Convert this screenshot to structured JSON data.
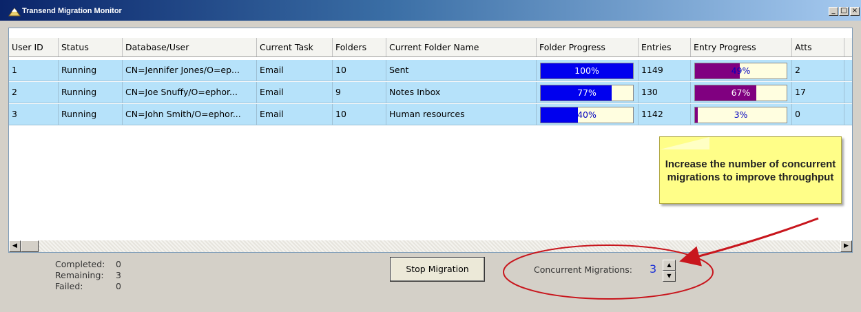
{
  "window": {
    "title": "Transend Migration Monitor"
  },
  "columns": [
    "User ID",
    "Status",
    "Database/User",
    "Current Task",
    "Folders",
    "Current Folder Name",
    "Folder Progress",
    "Entries",
    "Entry Progress",
    "Atts"
  ],
  "rows": [
    {
      "user_id": "1",
      "status": "Running",
      "database_user": "CN=Jennifer Jones/O=ep...",
      "current_task": "Email",
      "folders": "10",
      "current_folder_name": "Sent",
      "folder_progress_text": "100%",
      "folder_progress": 1.0,
      "entries": "1149",
      "entry_progress_text": "49%",
      "entry_progress": 0.49,
      "atts": "2"
    },
    {
      "user_id": "2",
      "status": "Running",
      "database_user": "CN=Joe Snuffy/O=ephor...",
      "current_task": "Email",
      "folders": "9",
      "current_folder_name": "Notes Inbox",
      "folder_progress_text": "77%",
      "folder_progress": 0.77,
      "entries": "130",
      "entry_progress_text": "67%",
      "entry_progress": 0.67,
      "atts": "17"
    },
    {
      "user_id": "3",
      "status": "Running",
      "database_user": "CN=John Smith/O=ephor...",
      "current_task": "Email",
      "folders": "10",
      "current_folder_name": "Human resources",
      "folder_progress_text": "40%",
      "folder_progress": 0.4,
      "entries": "1142",
      "entry_progress_text": "3%",
      "entry_progress": 0.03,
      "atts": "0"
    }
  ],
  "callout": {
    "text": "Increase the number of concurrent migrations to improve throughput"
  },
  "stats": {
    "completed_label": "Completed:",
    "completed": "0",
    "remaining_label": "Remaining:",
    "remaining": "3",
    "failed_label": "Failed:",
    "failed": "0"
  },
  "stop_button": "Stop Migration",
  "concurrent": {
    "label": "Concurrent Migrations:",
    "value": "3"
  },
  "colors": {
    "folder_progress": "#0000ee",
    "entry_progress": "#800080",
    "row_bg": "#b6e2fa",
    "callout_bg": "#fffe88",
    "annotation": "#c8161d"
  },
  "icons": [
    "app-icon",
    "minimize-icon",
    "maximize-icon",
    "close-icon",
    "scroll-left-icon",
    "scroll-right-icon",
    "spin-up-icon",
    "spin-down-icon"
  ]
}
